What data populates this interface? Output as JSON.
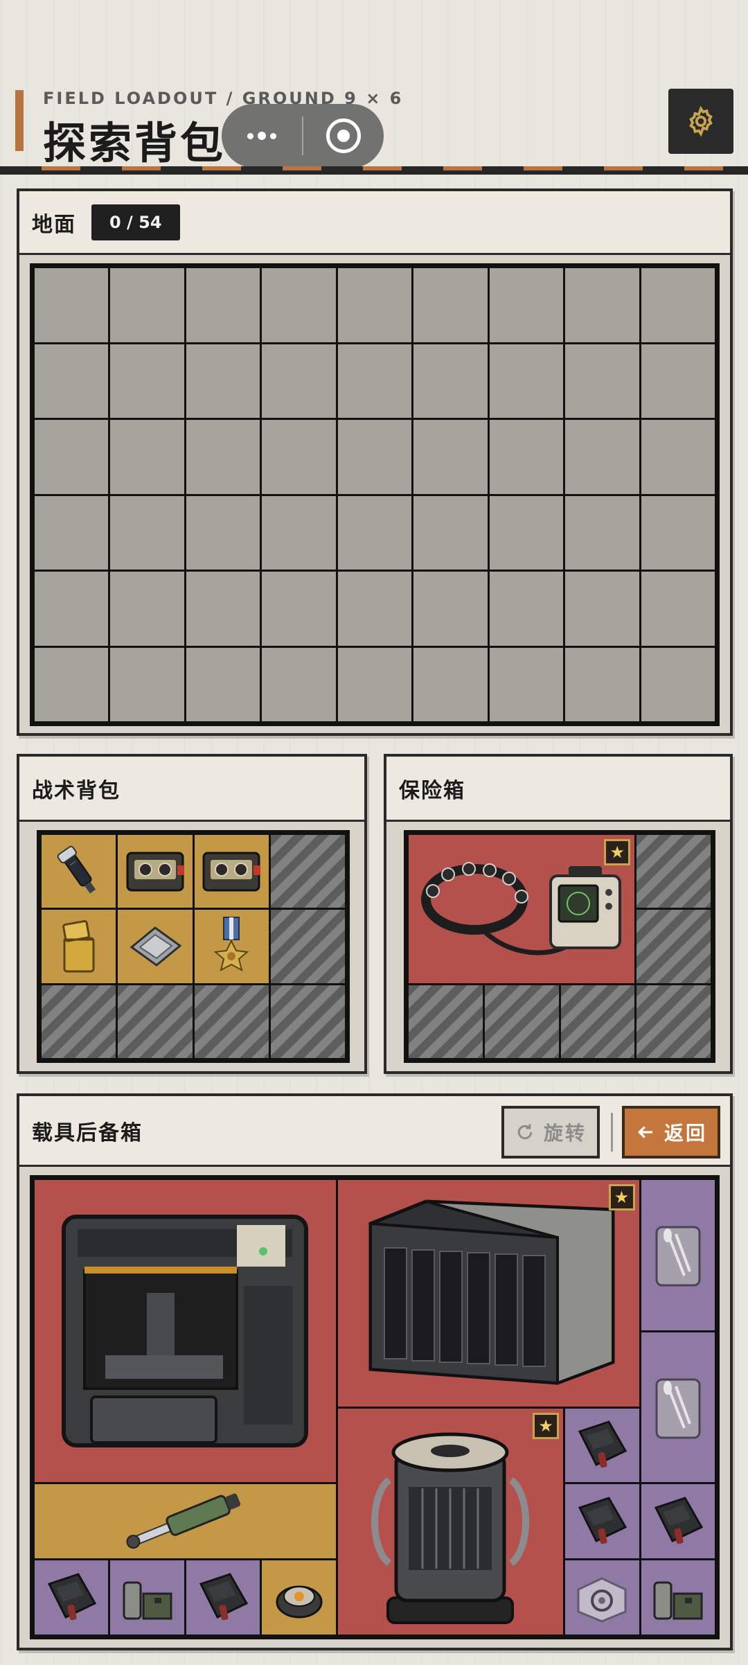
{
  "header": {
    "subtitle": "FIELD LOADOUT / GROUND 9 × 6",
    "title": "探索背包",
    "menu_icon": "more-dots-icon",
    "close_icon": "target-circle-icon",
    "settings_icon": "gear-icon"
  },
  "ground": {
    "title": "地面",
    "count": "0 / 54",
    "cols": 9,
    "rows": 6
  },
  "backpack": {
    "title": "战术背包",
    "cols": 4,
    "rows": 3,
    "items": [
      "flashlight-icon",
      "cassette-icon",
      "cassette-icon",
      "lighter-icon",
      "cpu-chip-icon",
      "medal-icon"
    ]
  },
  "safebox": {
    "title": "保险箱",
    "items": [
      "neural-headset-device-icon"
    ]
  },
  "vehicle": {
    "title": "载具后备箱",
    "rotate_label": "旋转",
    "back_label": "返回",
    "items": [
      "industrial-fabricator-icon",
      "server-rack-icon",
      "cutlery-icon",
      "cutlery-icon",
      "reactor-core-icon",
      "tactical-pouch-icon",
      "hydraulic-cylinder-icon",
      "tactical-pouch-icon",
      "tactical-pouch-icon",
      "tactical-pouch-icon",
      "canister-box-icon",
      "tactical-pouch-icon",
      "energy-core-icon",
      "bearing-case-icon",
      "canister-box-icon"
    ]
  },
  "colors": {
    "accent": "#b8743e",
    "gold_slot": "#c39947",
    "red_slot": "#b5514c",
    "purple_slot": "#8f7aa6"
  }
}
